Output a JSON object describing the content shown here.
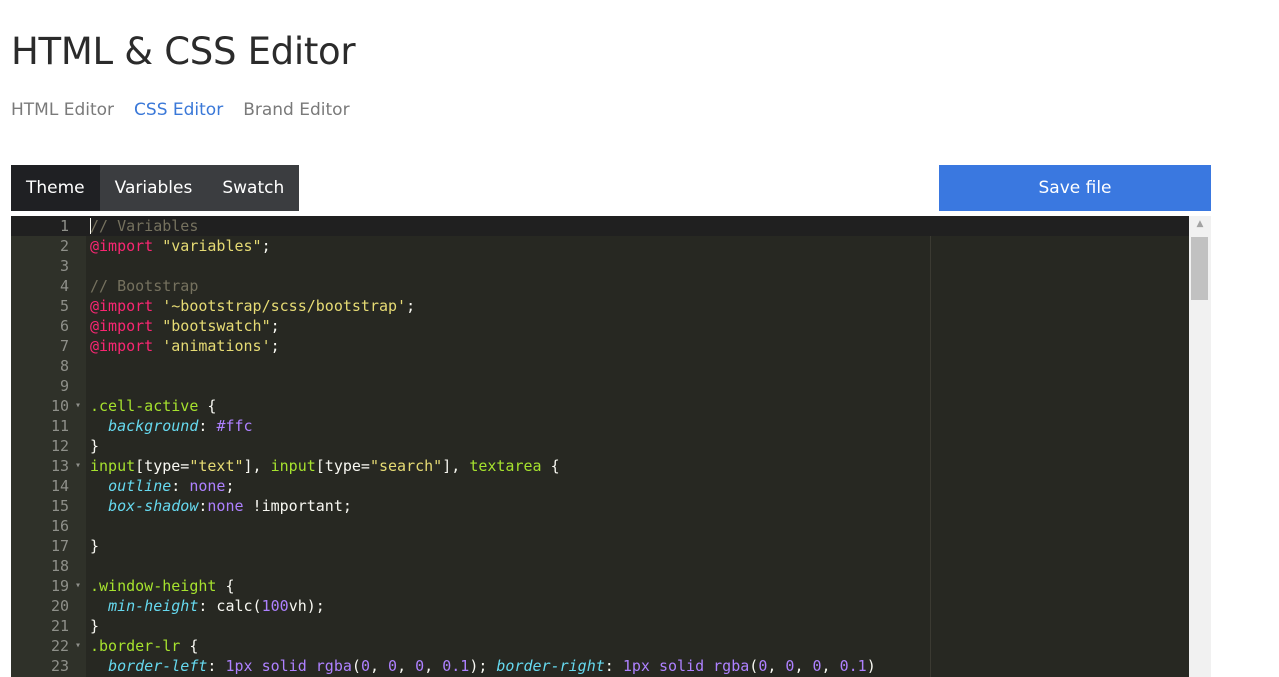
{
  "header": {
    "title": "HTML & CSS Editor",
    "nav": [
      {
        "label": "HTML Editor",
        "active": false
      },
      {
        "label": "CSS Editor",
        "active": true
      },
      {
        "label": "Brand Editor",
        "active": false
      }
    ]
  },
  "toolbar": {
    "tabs": [
      {
        "label": "Theme",
        "active": true
      },
      {
        "label": "Variables",
        "active": false
      },
      {
        "label": "Swatch",
        "active": false
      }
    ],
    "save_label": "Save file"
  },
  "editor": {
    "scroll_indicator": "▲",
    "current_line": 1,
    "colors": {
      "comment": "#75715e",
      "keyword": "#f92672",
      "string": "#e6db74",
      "selector": "#a6e22e",
      "property": "#66d9ef",
      "value": "#ae81ff",
      "plain": "#f8f8f2",
      "background": "#272822"
    },
    "lines": [
      {
        "n": "1",
        "fold": "",
        "tokens": [
          [
            "comment",
            "// Variables"
          ]
        ]
      },
      {
        "n": "2",
        "fold": "",
        "tokens": [
          [
            "keyword",
            "@import"
          ],
          [
            "plain",
            " "
          ],
          [
            "string",
            "\"variables\""
          ],
          [
            "plain",
            ";"
          ]
        ]
      },
      {
        "n": "3",
        "fold": "",
        "tokens": []
      },
      {
        "n": "4",
        "fold": "",
        "tokens": [
          [
            "comment",
            "// Bootstrap"
          ]
        ]
      },
      {
        "n": "5",
        "fold": "",
        "tokens": [
          [
            "keyword",
            "@import"
          ],
          [
            "plain",
            " "
          ],
          [
            "string",
            "'~bootstrap/scss/bootstrap'"
          ],
          [
            "plain",
            ";"
          ]
        ]
      },
      {
        "n": "6",
        "fold": "",
        "tokens": [
          [
            "keyword",
            "@import"
          ],
          [
            "plain",
            " "
          ],
          [
            "string",
            "\"bootswatch\""
          ],
          [
            "plain",
            ";"
          ]
        ]
      },
      {
        "n": "7",
        "fold": "",
        "tokens": [
          [
            "keyword",
            "@import"
          ],
          [
            "plain",
            " "
          ],
          [
            "string",
            "'animations'"
          ],
          [
            "plain",
            ";"
          ]
        ]
      },
      {
        "n": "8",
        "fold": "",
        "tokens": []
      },
      {
        "n": "9",
        "fold": "",
        "tokens": []
      },
      {
        "n": "10",
        "fold": "▾",
        "tokens": [
          [
            "selector",
            ".cell-active"
          ],
          [
            "plain",
            " {"
          ]
        ]
      },
      {
        "n": "11",
        "fold": "",
        "tokens": [
          [
            "plain",
            "  "
          ],
          [
            "prop",
            "background"
          ],
          [
            "plain",
            ": "
          ],
          [
            "value",
            "#ffc"
          ]
        ]
      },
      {
        "n": "12",
        "fold": "",
        "tokens": [
          [
            "plain",
            "}"
          ]
        ]
      },
      {
        "n": "13",
        "fold": "▾",
        "tokens": [
          [
            "selector",
            "input"
          ],
          [
            "plain",
            "[type="
          ],
          [
            "string",
            "\"text\""
          ],
          [
            "plain",
            "], "
          ],
          [
            "selector",
            "input"
          ],
          [
            "plain",
            "[type="
          ],
          [
            "string",
            "\"search\""
          ],
          [
            "plain",
            "], "
          ],
          [
            "selector",
            "textarea"
          ],
          [
            "plain",
            " {"
          ]
        ]
      },
      {
        "n": "14",
        "fold": "",
        "tokens": [
          [
            "plain",
            "  "
          ],
          [
            "prop",
            "outline"
          ],
          [
            "plain",
            ": "
          ],
          [
            "value",
            "none"
          ],
          [
            "plain",
            ";"
          ]
        ]
      },
      {
        "n": "15",
        "fold": "",
        "tokens": [
          [
            "plain",
            "  "
          ],
          [
            "prop",
            "box-shadow"
          ],
          [
            "plain",
            ":"
          ],
          [
            "value",
            "none"
          ],
          [
            "plain",
            " !important;"
          ]
        ]
      },
      {
        "n": "16",
        "fold": "",
        "tokens": []
      },
      {
        "n": "17",
        "fold": "",
        "tokens": [
          [
            "plain",
            "}"
          ]
        ]
      },
      {
        "n": "18",
        "fold": "",
        "tokens": []
      },
      {
        "n": "19",
        "fold": "▾",
        "tokens": [
          [
            "selector",
            ".window-height"
          ],
          [
            "plain",
            " {"
          ]
        ]
      },
      {
        "n": "20",
        "fold": "",
        "tokens": [
          [
            "plain",
            "  "
          ],
          [
            "prop",
            "min-height"
          ],
          [
            "plain",
            ": calc("
          ],
          [
            "value",
            "100"
          ],
          [
            "plain",
            "vh);"
          ]
        ]
      },
      {
        "n": "21",
        "fold": "",
        "tokens": [
          [
            "plain",
            "}"
          ]
        ]
      },
      {
        "n": "22",
        "fold": "▾",
        "tokens": [
          [
            "selector",
            ".border-lr"
          ],
          [
            "plain",
            " {"
          ]
        ]
      },
      {
        "n": "23",
        "fold": "",
        "tokens": [
          [
            "plain",
            "  "
          ],
          [
            "prop",
            "border-left"
          ],
          [
            "plain",
            ": "
          ],
          [
            "value",
            "1px"
          ],
          [
            "plain",
            " "
          ],
          [
            "value",
            "solid"
          ],
          [
            "plain",
            " "
          ],
          [
            "value",
            "rgba"
          ],
          [
            "plain",
            "("
          ],
          [
            "value",
            "0"
          ],
          [
            "plain",
            ", "
          ],
          [
            "value",
            "0"
          ],
          [
            "plain",
            ", "
          ],
          [
            "value",
            "0"
          ],
          [
            "plain",
            ", "
          ],
          [
            "value",
            "0.1"
          ],
          [
            "plain",
            "); "
          ],
          [
            "prop",
            "border-right"
          ],
          [
            "plain",
            ": "
          ],
          [
            "value",
            "1px"
          ],
          [
            "plain",
            " "
          ],
          [
            "value",
            "solid"
          ],
          [
            "plain",
            " "
          ],
          [
            "value",
            "rgba"
          ],
          [
            "plain",
            "("
          ],
          [
            "value",
            "0"
          ],
          [
            "plain",
            ", "
          ],
          [
            "value",
            "0"
          ],
          [
            "plain",
            ", "
          ],
          [
            "value",
            "0"
          ],
          [
            "plain",
            ", "
          ],
          [
            "value",
            "0.1"
          ],
          [
            "plain",
            ")"
          ]
        ]
      }
    ]
  }
}
